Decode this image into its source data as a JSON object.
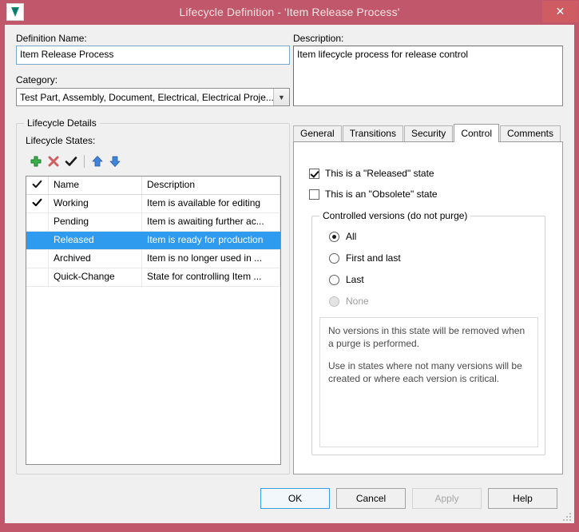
{
  "window": {
    "title": "Lifecycle Definition - 'Item Release Process'",
    "icon": "vault-v-icon",
    "close_label": "✕",
    "titlebar_color": "#c0576a",
    "accent_color": "#2f9bef"
  },
  "form": {
    "definition_name_label": "Definition Name:",
    "definition_name_value": "Item Release Process",
    "category_label": "Category:",
    "category_value": "Test Part, Assembly, Document, Electrical, Electrical Proje...",
    "description_label": "Description:",
    "description_value": "Item lifecycle process for release control"
  },
  "lifecycle_details": {
    "group_title": "Lifecycle Details",
    "states_label": "Lifecycle States:",
    "toolbar": [
      {
        "name": "add-state-button",
        "icon": "plus-icon"
      },
      {
        "name": "delete-state-button",
        "icon": "delete-x-icon"
      },
      {
        "name": "set-default-state-button",
        "icon": "checkmark-icon"
      },
      {
        "name": "move-up-button",
        "icon": "arrow-up-icon"
      },
      {
        "name": "move-down-button",
        "icon": "arrow-down-icon"
      }
    ],
    "columns": [
      "",
      "Name",
      "Description"
    ],
    "header_check_icon": "checkmark-icon",
    "rows": [
      {
        "checked": true,
        "name": "Working",
        "description": "Item is available for editing",
        "selected": false
      },
      {
        "checked": false,
        "name": "Pending",
        "description": "Item is awaiting further ac...",
        "selected": false
      },
      {
        "checked": false,
        "name": "Released",
        "description": "Item is ready for production",
        "selected": true
      },
      {
        "checked": false,
        "name": "Archived",
        "description": "Item is no longer used in ...",
        "selected": false
      },
      {
        "checked": false,
        "name": "Quick-Change",
        "description": "State for controlling Item ...",
        "selected": false
      }
    ]
  },
  "tabs": [
    {
      "label": "General",
      "active": false
    },
    {
      "label": "Transitions",
      "active": false
    },
    {
      "label": "Security",
      "active": false
    },
    {
      "label": "Control",
      "active": true
    },
    {
      "label": "Comments",
      "active": false
    }
  ],
  "control_tab": {
    "released_checkbox": {
      "label": "This is a \"Released\" state",
      "checked": true
    },
    "obsolete_checkbox": {
      "label": "This is an \"Obsolete\" state",
      "checked": false
    },
    "controlled_versions": {
      "group_title": "Controlled versions (do not purge)",
      "options": [
        {
          "label": "All",
          "selected": true,
          "disabled": false
        },
        {
          "label": "First and last",
          "selected": false,
          "disabled": false
        },
        {
          "label": "Last",
          "selected": false,
          "disabled": false
        },
        {
          "label": "None",
          "selected": false,
          "disabled": true
        }
      ],
      "info_paragraph_1": "No versions in this state will be removed when a purge is performed.",
      "info_paragraph_2": "Use in states where not many versions will be created or where each version is critical."
    }
  },
  "buttons": {
    "ok": {
      "label": "OK",
      "default": true,
      "disabled": false
    },
    "cancel": {
      "label": "Cancel",
      "default": false,
      "disabled": false
    },
    "apply": {
      "label": "Apply",
      "default": false,
      "disabled": true
    },
    "help": {
      "label": "Help",
      "default": false,
      "disabled": false
    }
  }
}
